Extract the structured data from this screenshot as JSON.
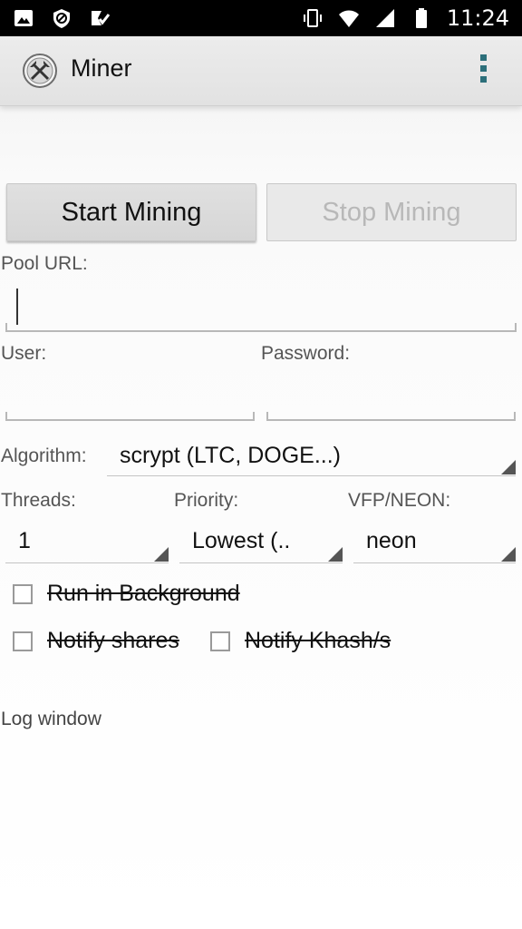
{
  "status_bar": {
    "time": "11:24",
    "left_icons": [
      "image-icon",
      "vpn-shield-icon",
      "task-check-icon"
    ],
    "right_icons": [
      "vibrate-icon",
      "wifi-icon",
      "signal-icon",
      "battery-icon"
    ]
  },
  "app_bar": {
    "title": "Miner",
    "icon": "miner-pickaxe-icon",
    "menu_icon": "overflow-menu-icon"
  },
  "buttons": {
    "start": "Start Mining",
    "stop": "Stop Mining"
  },
  "form": {
    "pool_url": {
      "label": "Pool URL:",
      "value": ""
    },
    "user": {
      "label": "User:",
      "value": ""
    },
    "password": {
      "label": "Password:",
      "value": ""
    },
    "algorithm": {
      "label": "Algorithm:",
      "value": "scrypt (LTC, DOGE...)"
    },
    "threads": {
      "label": "Threads:",
      "value": "1"
    },
    "priority": {
      "label": "Priority:",
      "value": "Lowest (.."
    },
    "vfp": {
      "label": "VFP/NEON:",
      "value": "neon"
    }
  },
  "checkboxes": {
    "run_background": {
      "label": "Run in Background",
      "checked": false
    },
    "notify_shares": {
      "label": "Notify shares",
      "checked": false
    },
    "notify_khash": {
      "label": "Notify Khash/s",
      "checked": false
    }
  },
  "log": {
    "label": "Log window"
  },
  "colors": {
    "overflow_dots": "#2c6f7a",
    "status_bar": "#000000"
  }
}
